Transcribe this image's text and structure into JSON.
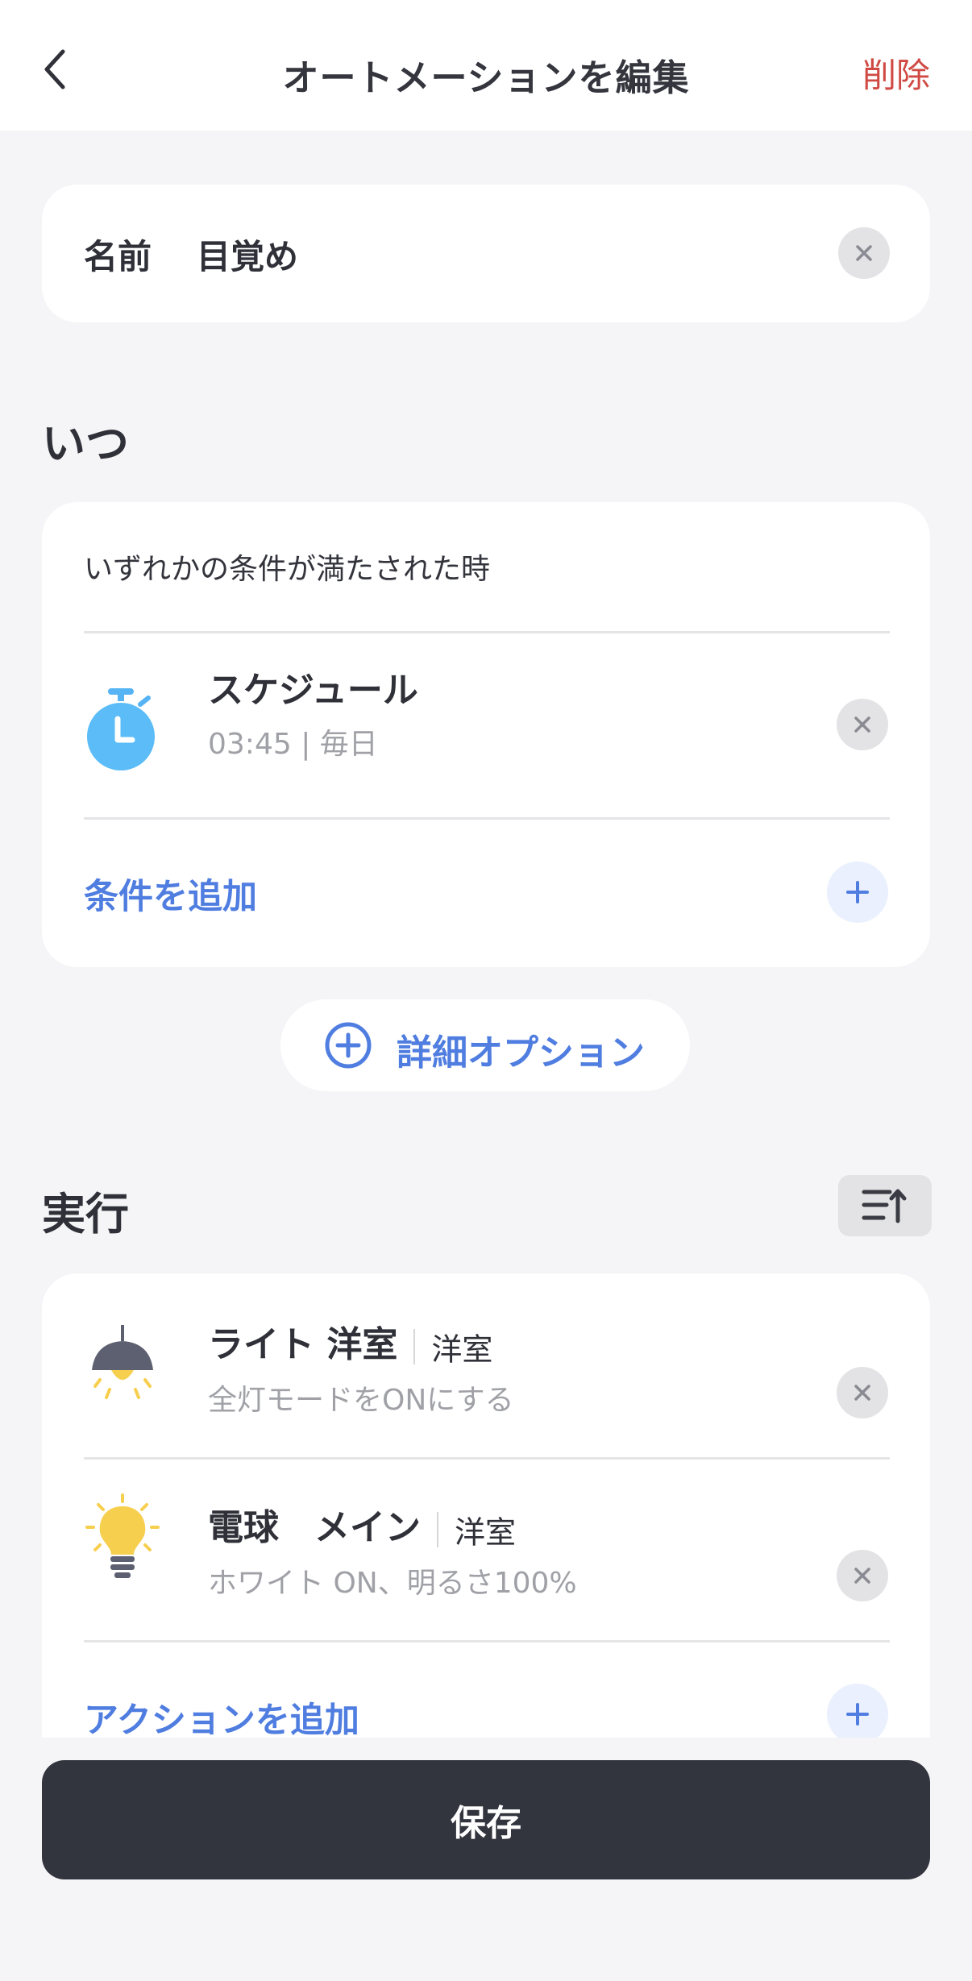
{
  "header": {
    "title": "オートメーションを編集",
    "delete_label": "削除",
    "back_icon": "chevron-left-icon"
  },
  "name_card": {
    "label": "名前",
    "value": "目覚め"
  },
  "when": {
    "section_title": "いつ",
    "condition_mode": "いずれかの条件が満たされた時",
    "items": [
      {
        "icon": "stopwatch-icon",
        "title": "スケジュール",
        "subtitle": "03:45 | 毎日"
      }
    ],
    "add_condition_label": "条件を追加"
  },
  "advanced_options_label": "詳細オプション",
  "execute": {
    "section_title": "実行",
    "items": [
      {
        "icon": "ceiling-lamp-icon",
        "title": "ライト 洋室",
        "room": "洋室",
        "subtitle": "全灯モードをONにする"
      },
      {
        "icon": "light-bulb-icon",
        "title": "電球　メイン",
        "room": "洋室",
        "subtitle": "ホワイト ON、明るさ100%"
      }
    ],
    "add_action_label": "アクションを追加"
  },
  "save_label": "保存",
  "colors": {
    "accent": "#4f7de0",
    "delete": "#d04a43",
    "save_button": "#32343e",
    "background": "#f5f5f7"
  }
}
